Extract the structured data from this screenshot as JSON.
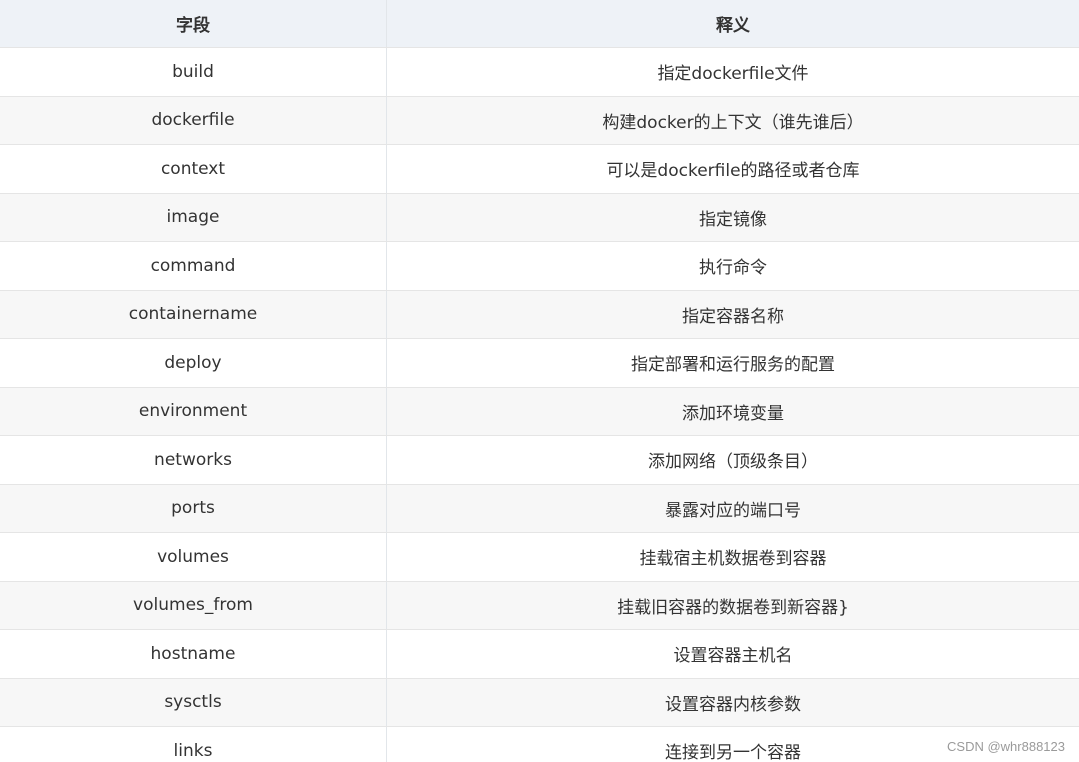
{
  "table": {
    "headers": {
      "field": "字段",
      "meaning": "释义"
    },
    "rows": [
      {
        "field": "build",
        "meaning": "指定dockerfile文件"
      },
      {
        "field": "dockerfile",
        "meaning": "构建docker的上下文（谁先谁后）"
      },
      {
        "field": "context",
        "meaning": "可以是dockerfile的路径或者仓库"
      },
      {
        "field": "image",
        "meaning": "指定镜像"
      },
      {
        "field": "command",
        "meaning": "执行命令"
      },
      {
        "field": "containername",
        "meaning": "指定容器名称"
      },
      {
        "field": "deploy",
        "meaning": "指定部署和运行服务的配置"
      },
      {
        "field": "environment",
        "meaning": "添加环境变量"
      },
      {
        "field": "networks",
        "meaning": "添加网络（顶级条目）"
      },
      {
        "field": "ports",
        "meaning": "暴露对应的端口号"
      },
      {
        "field": "volumes",
        "meaning": "挂载宿主机数据卷到容器"
      },
      {
        "field": "volumes_from",
        "meaning": "挂载旧容器的数据卷到新容器}"
      },
      {
        "field": "hostname",
        "meaning": "设置容器主机名"
      },
      {
        "field": "sysctls",
        "meaning": "设置容器内核参数"
      },
      {
        "field": "links",
        "meaning": "连接到另一个容器"
      }
    ]
  },
  "watermark": "CSDN @whr888123"
}
